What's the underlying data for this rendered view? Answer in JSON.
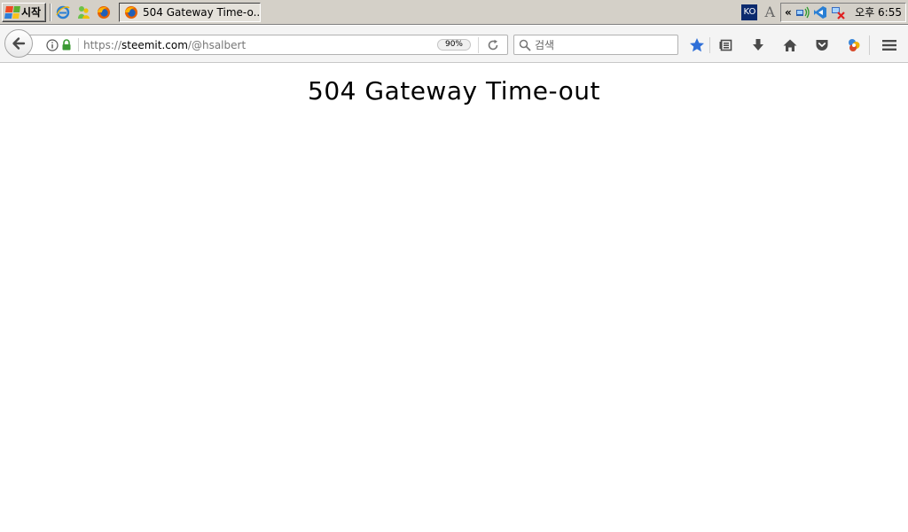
{
  "taskbar": {
    "start_label": "시작",
    "quick_launch": [
      {
        "name": "ie-icon"
      },
      {
        "name": "messenger-icon"
      },
      {
        "name": "firefox-icon"
      }
    ],
    "active_task_label": "504 Gateway Time-o...",
    "ime_label": "KO",
    "font_label": "A",
    "tray_chevron": "«",
    "clock": "오후 6:55"
  },
  "browser": {
    "url_scheme": "https://",
    "url_host": "steemit.com",
    "url_path": "/@hsalbert",
    "zoom": "90%",
    "search_placeholder": "검색"
  },
  "page": {
    "title": "504 Gateway Time-out"
  },
  "colors": {
    "bookmark_star": "#2f6fd8",
    "secure_lock": "#3c9a34"
  }
}
